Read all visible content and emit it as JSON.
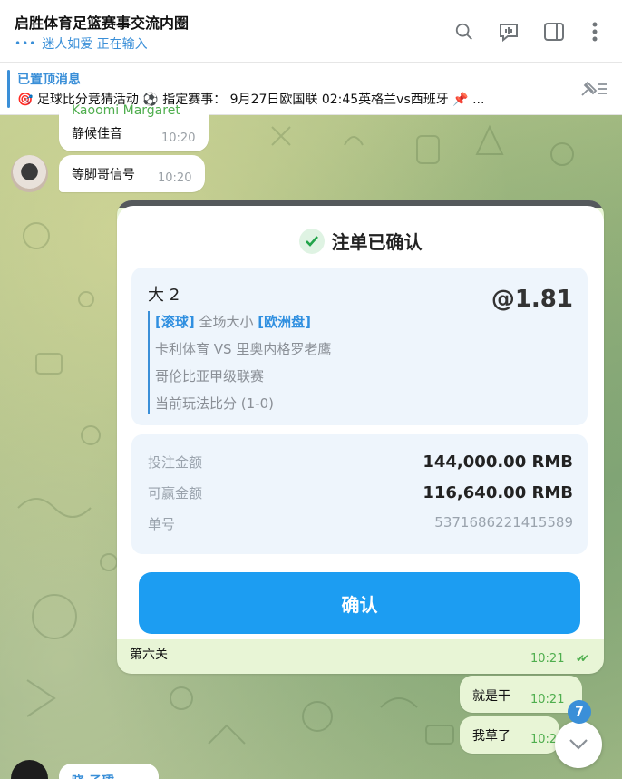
{
  "header": {
    "title": "启胜体育足篮赛事交流内圈",
    "typing_status": "迷人如爱 正在输入"
  },
  "pinned": {
    "title": "已置顶消息",
    "text": "🎯 足球比分竞猜活动 ⚽ 指定赛事：  9月27日欧国联 02:45英格兰vs西班牙  📌 ..."
  },
  "messages": {
    "partial_sender": "Kaoomi Margaret",
    "msg1_text": "静候佳音",
    "msg1_time": "10:20",
    "msg2_text": "等脚哥信号",
    "msg2_time": "10:20",
    "bottom_sender": "晓 子珺"
  },
  "bet_card": {
    "title": "注单已确认",
    "bet_name": "大 2",
    "odds": "@1.81",
    "tag_live": "[滚球]",
    "market": " 全场大小 ",
    "tag_euro": "[欧洲盘]",
    "match": "卡利体育 VS 里奥内格罗老鹰",
    "league": "哥伦比亚甲级联赛",
    "current_score": "当前玩法比分 (1-0)",
    "stake_label": "投注金额",
    "stake_value": "144,000.00 RMB",
    "win_label": "可赢金额",
    "win_value": "116,640.00 RMB",
    "order_label": "单号",
    "order_value": "5371686221415589",
    "confirm_label": "确认",
    "caption": "第六关",
    "time": "10:21"
  },
  "outgoing": [
    {
      "text": "就是干",
      "time": "10:21"
    },
    {
      "text": "我草了",
      "time": "10:21"
    }
  ],
  "scroll": {
    "unread_count": "7"
  }
}
